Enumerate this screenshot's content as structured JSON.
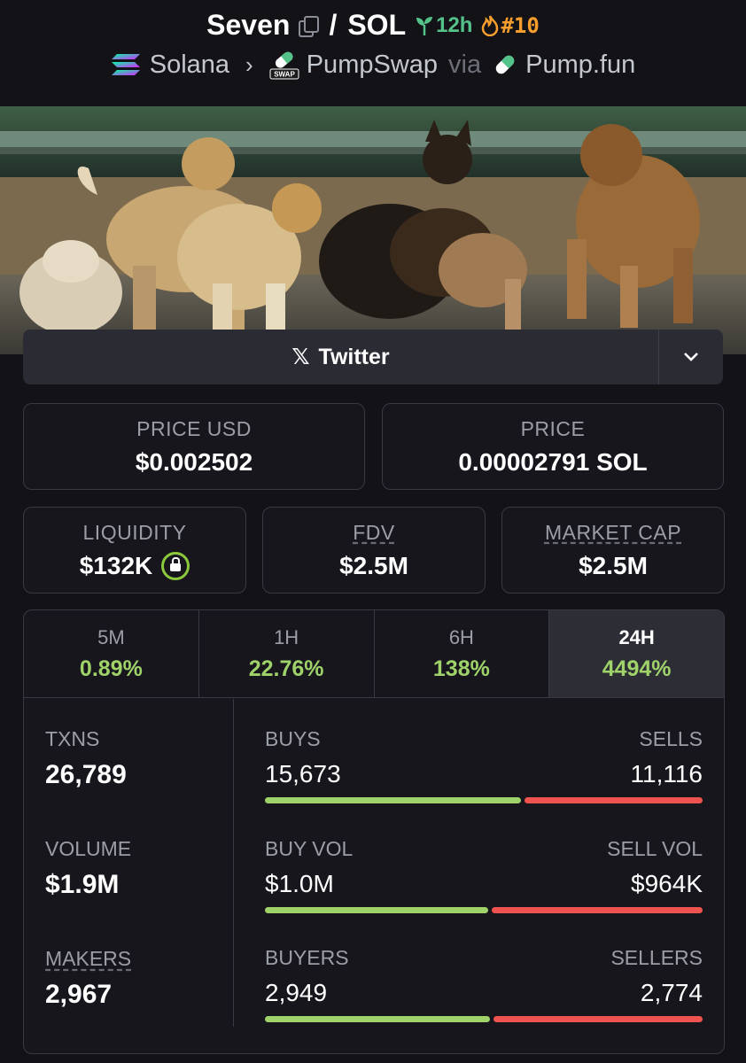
{
  "header": {
    "token": "Seven",
    "quote": "SOL",
    "separator": "/",
    "age": "12h",
    "rank": "#10",
    "chain": "Solana",
    "dex": "PumpSwap",
    "via": "via",
    "launchpad": "Pump.fun",
    "dex_badge": "SWAP"
  },
  "links": {
    "twitter_label": "Twitter",
    "twitter_glyph": "𝕏"
  },
  "prices": {
    "price_usd_label": "PRICE USD",
    "price_usd": "$0.002502",
    "price_label": "PRICE",
    "price_native": "0.00002791 SOL"
  },
  "market": {
    "liquidity_label": "LIQUIDITY",
    "liquidity": "$132K",
    "fdv_label": "FDV",
    "fdv": "$2.5M",
    "mcap_label": "MARKET CAP",
    "mcap": "$2.5M"
  },
  "timeframes": [
    {
      "label": "5M",
      "change": "0.89%"
    },
    {
      "label": "1H",
      "change": "22.76%"
    },
    {
      "label": "6H",
      "change": "138%"
    },
    {
      "label": "24H",
      "change": "4494%"
    }
  ],
  "selected_timeframe": "24H",
  "stats": {
    "txns_label": "TXNS",
    "txns": "26,789",
    "volume_label": "VOLUME",
    "volume": "$1.9M",
    "makers_label": "MAKERS",
    "makers": "2,967",
    "buys_label": "BUYS",
    "buys": "15,673",
    "sells_label": "SELLS",
    "sells": "11,116",
    "buy_vol_label": "BUY VOL",
    "buy_vol": "$1.0M",
    "sell_vol_label": "SELL VOL",
    "sell_vol": "$964K",
    "buyers_label": "BUYERS",
    "buyers": "2,949",
    "sellers_label": "SELLERS",
    "sellers": "2,774"
  },
  "ratios": {
    "buys_share": 0.585,
    "buy_vol_share": 0.51,
    "buyers_share": 0.515
  },
  "colors": {
    "positive": "#9fd36a",
    "negative": "#ef5350",
    "age": "#54c38a",
    "rank": "#f59e2e",
    "background": "#121217"
  }
}
